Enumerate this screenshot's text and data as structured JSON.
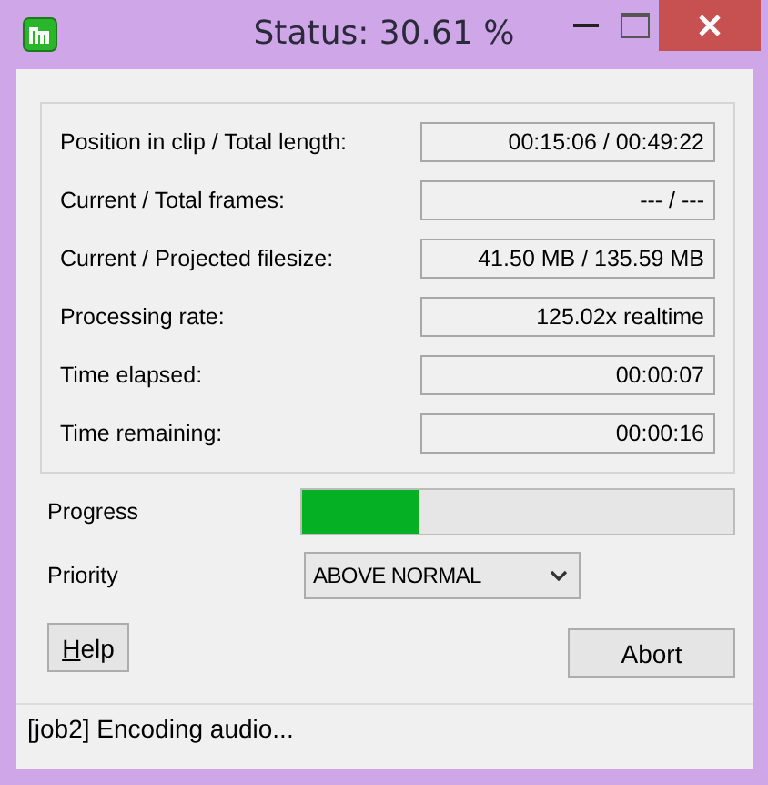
{
  "window": {
    "title": "Status: 30.61 %"
  },
  "info": [
    {
      "label": "Position in clip / Total length:",
      "value": "00:15:06 / 00:49:22"
    },
    {
      "label": "Current / Total frames:",
      "value": "--- / ---"
    },
    {
      "label": "Current / Projected filesize:",
      "value": "41.50 MB / 135.59 MB"
    },
    {
      "label": "Processing rate:",
      "value": "125.02x realtime"
    },
    {
      "label": "Time elapsed:",
      "value": "00:00:07"
    },
    {
      "label": "Time remaining:",
      "value": "00:00:16"
    }
  ],
  "progress": {
    "label": "Progress",
    "level": 0.27
  },
  "priority": {
    "label": "Priority",
    "value": "ABOVE NORMAL"
  },
  "buttons": [
    {
      "label": "Help",
      "mnemonic": true
    },
    {
      "label": "Abort"
    }
  ],
  "status_bar": "[job2]  Encoding audio..."
}
